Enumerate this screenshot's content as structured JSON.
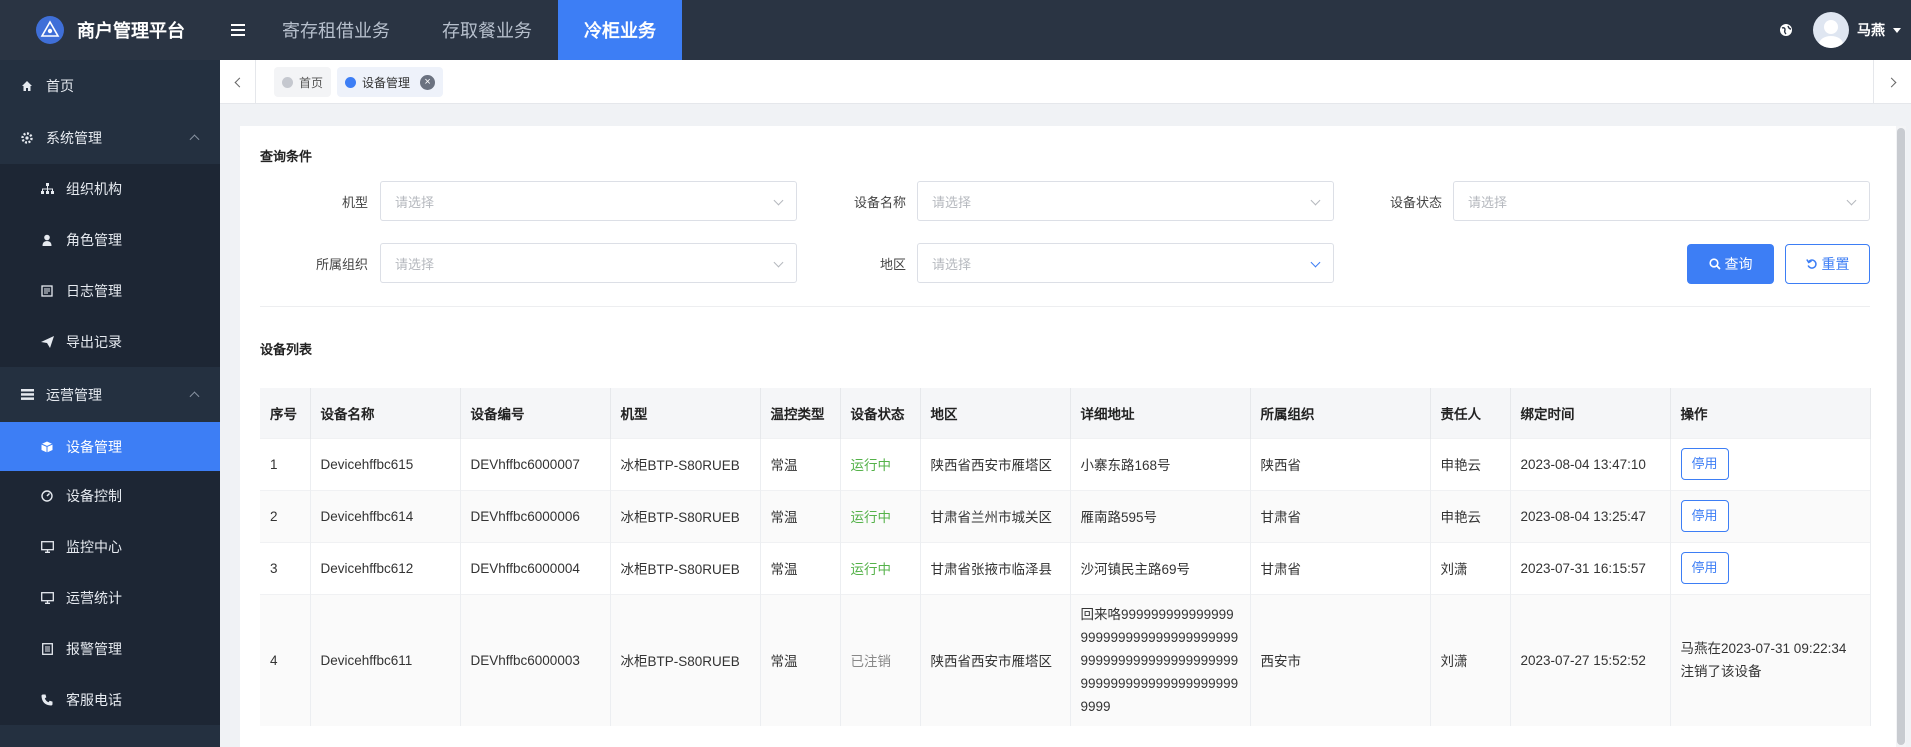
{
  "header": {
    "brand": "商户管理平台",
    "top_tabs": [
      {
        "label": "寄存租借业务",
        "active": false
      },
      {
        "label": "存取餐业务",
        "active": false
      },
      {
        "label": "冷柜业务",
        "active": true
      }
    ],
    "user_name": "马燕",
    "accent_color": "#3d7ef5"
  },
  "sidebar": {
    "home": "首页",
    "groups": [
      {
        "label": "系统管理",
        "icon": "gear-icon",
        "items": [
          {
            "label": "组织机构",
            "icon": "org-icon"
          },
          {
            "label": "角色管理",
            "icon": "user-icon"
          },
          {
            "label": "日志管理",
            "icon": "log-icon"
          },
          {
            "label": "导出记录",
            "icon": "send-icon"
          }
        ]
      },
      {
        "label": "运营管理",
        "icon": "list-icon",
        "items": [
          {
            "label": "设备管理",
            "icon": "box-icon",
            "active": true
          },
          {
            "label": "设备控制",
            "icon": "dial-icon"
          },
          {
            "label": "监控中心",
            "icon": "monitor-icon"
          },
          {
            "label": "运营统计",
            "icon": "monitor-icon"
          },
          {
            "label": "报警管理",
            "icon": "doc-icon"
          },
          {
            "label": "客服电话",
            "icon": "phone-icon"
          }
        ]
      }
    ]
  },
  "tabs": {
    "items": [
      {
        "label": "首页",
        "active": false
      },
      {
        "label": "设备管理",
        "active": true
      }
    ]
  },
  "query": {
    "title": "查询条件",
    "fields": {
      "model": {
        "label": "机型",
        "placeholder": "请选择"
      },
      "device_name": {
        "label": "设备名称",
        "placeholder": "请选择"
      },
      "device_status": {
        "label": "设备状态",
        "placeholder": "请选择"
      },
      "org": {
        "label": "所属组织",
        "placeholder": "请选择"
      },
      "region": {
        "label": "地区",
        "placeholder": "请选择"
      }
    },
    "search_label": "查询",
    "reset_label": "重置"
  },
  "device_list": {
    "title": "设备列表",
    "columns": [
      "序号",
      "设备名称",
      "设备编号",
      "机型",
      "温控类型",
      "设备状态",
      "地区",
      "详细地址",
      "所属组织",
      "责任人",
      "绑定时间",
      "操作"
    ],
    "rows": [
      {
        "no": "1",
        "name": "Devicehffbc615",
        "code": "DEVhffbc6000007",
        "model": "冰柜BTP-S80RUEB",
        "temp": "常温",
        "status": "运行中",
        "region": "陕西省西安市雁塔区",
        "address": "小寨东路168号",
        "org": "陕西省",
        "owner": "申艳云",
        "bind_time": "2023-08-04 13:47:10",
        "action": "停用"
      },
      {
        "no": "2",
        "name": "Devicehffbc614",
        "code": "DEVhffbc6000006",
        "model": "冰柜BTP-S80RUEB",
        "temp": "常温",
        "status": "运行中",
        "region": "甘肃省兰州市城关区",
        "address": "雁南路595号",
        "org": "甘肃省",
        "owner": "申艳云",
        "bind_time": "2023-08-04 13:25:47",
        "action": "停用"
      },
      {
        "no": "3",
        "name": "Devicehffbc612",
        "code": "DEVhffbc6000004",
        "model": "冰柜BTP-S80RUEB",
        "temp": "常温",
        "status": "运行中",
        "region": "甘肃省张掖市临泽县",
        "address": "沙河镇民主路69号",
        "org": "甘肃省",
        "owner": "刘潇",
        "bind_time": "2023-07-31 16:15:57",
        "action": "停用"
      },
      {
        "no": "4",
        "name": "Devicehffbc611",
        "code": "DEVhffbc6000003",
        "model": "冰柜BTP-S80RUEB",
        "temp": "常温",
        "status": "已注销",
        "region": "陕西省西安市雁塔区",
        "address": "回来咯9999999999999999999999999999999999999999999999999999999999999999999999999999999999",
        "org": "西安市",
        "owner": "刘潇",
        "bind_time": "2023-07-27 15:52:52",
        "action": "马燕在2023-07-31 09:22:34注销了该设备"
      }
    ]
  }
}
